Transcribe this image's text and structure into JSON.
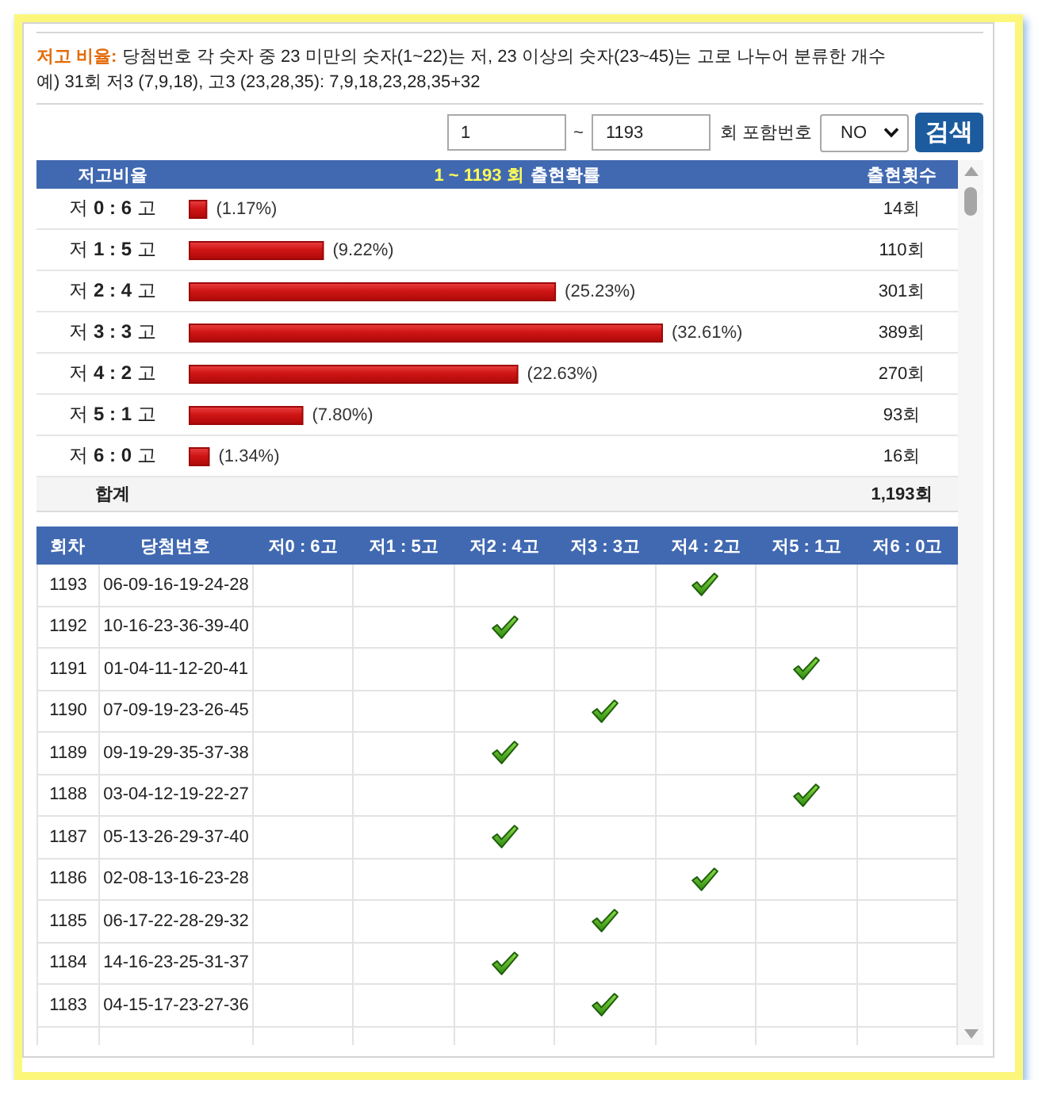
{
  "description": {
    "label": "저고 비율:",
    "text": "당첨번호 각 숫자 중 23 미만의 숫자(1~22)는 저, 23 이상의 숫자(23~45)는 고로 나누어 분류한 개수",
    "example": "예) 31회 저3 (7,9,18), 고3 (23,28,35): 7,9,18,23,28,35+32"
  },
  "search": {
    "from": "1",
    "separator": "~",
    "to": "1193",
    "unit_label": "회 포함번호",
    "bonus_select": "NO",
    "button": "검색"
  },
  "ratio_table": {
    "header": {
      "ratio": "저고비율",
      "range": "1 ~ 1193 회",
      "title": "출현확률",
      "count": "출현횟수"
    },
    "chart_data": {
      "type": "bar",
      "orientation": "horizontal",
      "categories": [
        "저 **0 : 6** 고",
        "저 **1 : 5** 고",
        "저 **2 : 4** 고",
        "저 **3 : 3** 고",
        "저 **4 : 2** 고",
        "저 **5 : 1** 고",
        "저 **6 : 0** 고"
      ],
      "values": [
        1.17,
        9.22,
        25.23,
        32.61,
        22.63,
        7.8,
        1.34
      ],
      "value_labels": [
        "(1.17%)",
        "(9.22%)",
        "(25.23%)",
        "(32.61%)",
        "(22.63%)",
        "(7.80%)",
        "(1.34%)"
      ]
    },
    "counts": [
      "14회",
      "110회",
      "301회",
      "389회",
      "270회",
      "93회",
      "16회"
    ],
    "total": {
      "label": "합계",
      "count": "1,193회"
    }
  },
  "draw_table": {
    "columns": [
      "회차",
      "당첨번호",
      "저0 : 6고",
      "저1 : 5고",
      "저2 : 4고",
      "저3 : 3고",
      "저4 : 2고",
      "저5 : 1고",
      "저6 : 0고"
    ],
    "rows": [
      {
        "round": "1193",
        "numbers": "06-09-16-19-24-28",
        "cells": [
          {
            "checked": false
          },
          {
            "checked": false
          },
          {
            "checked": false
          },
          {
            "checked": false
          },
          {
            "checked": true
          },
          {
            "checked": false
          },
          {
            "checked": false
          }
        ]
      },
      {
        "round": "1192",
        "numbers": "10-16-23-36-39-40",
        "cells": [
          {
            "checked": false
          },
          {
            "checked": false
          },
          {
            "checked": true
          },
          {
            "checked": false
          },
          {
            "checked": false
          },
          {
            "checked": false
          },
          {
            "checked": false
          }
        ]
      },
      {
        "round": "1191",
        "numbers": "01-04-11-12-20-41",
        "cells": [
          {
            "checked": false
          },
          {
            "checked": false
          },
          {
            "checked": false
          },
          {
            "checked": false
          },
          {
            "checked": false
          },
          {
            "checked": true
          },
          {
            "checked": false
          }
        ]
      },
      {
        "round": "1190",
        "numbers": "07-09-19-23-26-45",
        "cells": [
          {
            "checked": false
          },
          {
            "checked": false
          },
          {
            "checked": false
          },
          {
            "checked": true
          },
          {
            "checked": false
          },
          {
            "checked": false
          },
          {
            "checked": false
          }
        ]
      },
      {
        "round": "1189",
        "numbers": "09-19-29-35-37-38",
        "cells": [
          {
            "checked": false
          },
          {
            "checked": false
          },
          {
            "checked": true
          },
          {
            "checked": false
          },
          {
            "checked": false
          },
          {
            "checked": false
          },
          {
            "checked": false
          }
        ]
      },
      {
        "round": "1188",
        "numbers": "03-04-12-19-22-27",
        "cells": [
          {
            "checked": false
          },
          {
            "checked": false
          },
          {
            "checked": false
          },
          {
            "checked": false
          },
          {
            "checked": false
          },
          {
            "checked": true
          },
          {
            "checked": false
          }
        ]
      },
      {
        "round": "1187",
        "numbers": "05-13-26-29-37-40",
        "cells": [
          {
            "checked": false
          },
          {
            "checked": false
          },
          {
            "checked": true
          },
          {
            "checked": false
          },
          {
            "checked": false
          },
          {
            "checked": false
          },
          {
            "checked": false
          }
        ]
      },
      {
        "round": "1186",
        "numbers": "02-08-13-16-23-28",
        "cells": [
          {
            "checked": false
          },
          {
            "checked": false
          },
          {
            "checked": false
          },
          {
            "checked": false
          },
          {
            "checked": true
          },
          {
            "checked": false
          },
          {
            "checked": false
          }
        ]
      },
      {
        "round": "1185",
        "numbers": "06-17-22-28-29-32",
        "cells": [
          {
            "checked": false
          },
          {
            "checked": false
          },
          {
            "checked": false
          },
          {
            "checked": true
          },
          {
            "checked": false
          },
          {
            "checked": false
          },
          {
            "checked": false
          }
        ]
      },
      {
        "round": "1184",
        "numbers": "14-16-23-25-31-37",
        "cells": [
          {
            "checked": false
          },
          {
            "checked": false
          },
          {
            "checked": true
          },
          {
            "checked": false
          },
          {
            "checked": false
          },
          {
            "checked": false
          },
          {
            "checked": false
          }
        ]
      },
      {
        "round": "1183",
        "numbers": "04-15-17-23-27-36",
        "cells": [
          {
            "checked": false
          },
          {
            "checked": false
          },
          {
            "checked": false
          },
          {
            "checked": true
          },
          {
            "checked": false
          },
          {
            "checked": false
          },
          {
            "checked": false
          }
        ]
      }
    ]
  }
}
